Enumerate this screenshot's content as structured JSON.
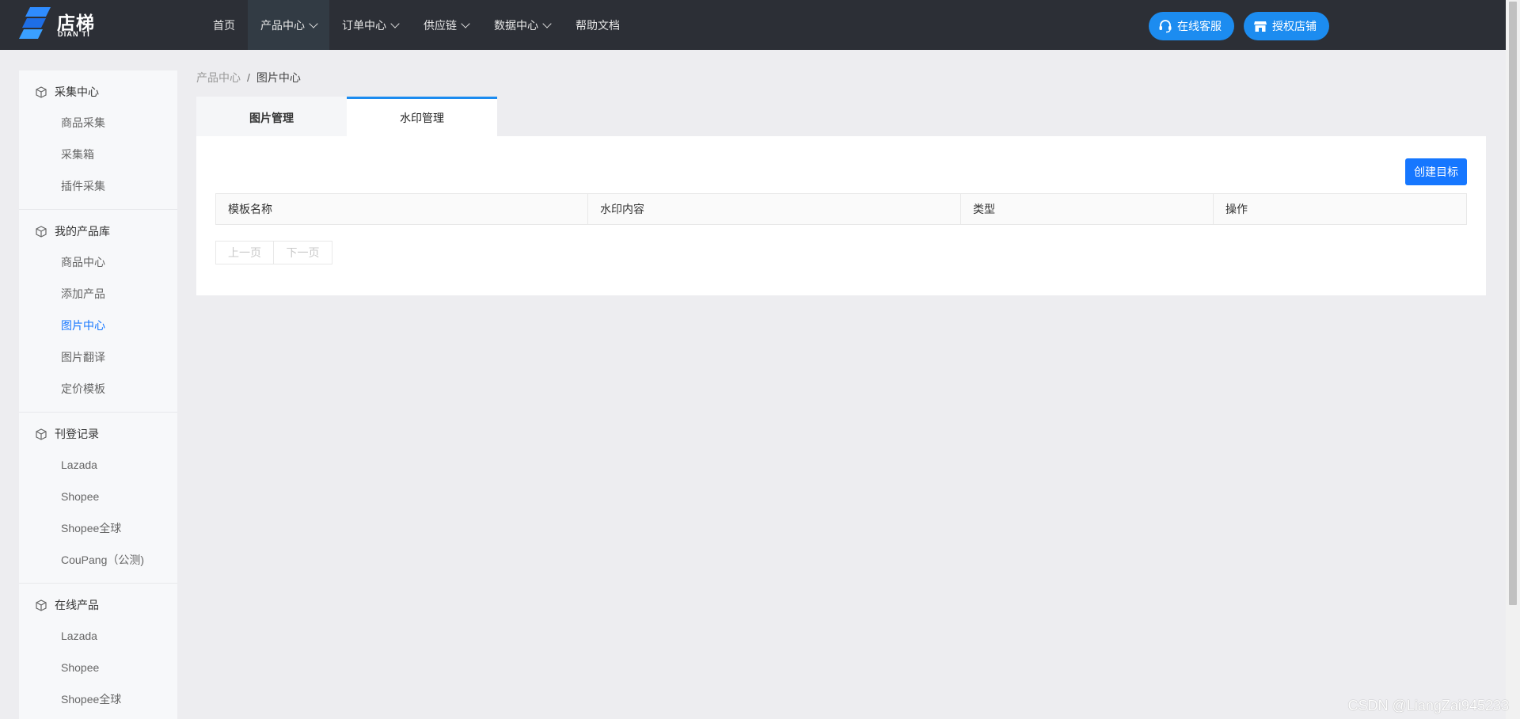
{
  "brand": {
    "name": "店梯",
    "sub": "DIAN TI"
  },
  "nav": [
    {
      "label": "首页",
      "dropdown": false,
      "active": false
    },
    {
      "label": "产品中心",
      "dropdown": true,
      "active": true
    },
    {
      "label": "订单中心",
      "dropdown": true,
      "active": false
    },
    {
      "label": "供应链",
      "dropdown": true,
      "active": false
    },
    {
      "label": "数据中心",
      "dropdown": true,
      "active": false
    },
    {
      "label": "帮助文档",
      "dropdown": false,
      "active": false
    }
  ],
  "header_buttons": {
    "service": "在线客服",
    "shop": "授权店铺"
  },
  "sidebar": [
    {
      "title": "采集中心",
      "items": [
        "商品采集",
        "采集箱",
        "插件采集"
      ]
    },
    {
      "title": "我的产品库",
      "items": [
        "商品中心",
        "添加产品",
        "图片中心",
        "图片翻译",
        "定价模板"
      ]
    },
    {
      "title": "刊登记录",
      "items": [
        "Lazada",
        "Shopee",
        "Shopee全球",
        "CouPang（公测)"
      ]
    },
    {
      "title": "在线产品",
      "items": [
        "Lazada",
        "Shopee",
        "Shopee全球"
      ]
    }
  ],
  "sidebar_active": "图片中心",
  "breadcrumb": {
    "parent": "产品中心",
    "separator": "/",
    "current": "图片中心"
  },
  "tabs": [
    {
      "label": "图片管理",
      "active": false
    },
    {
      "label": "水印管理",
      "active": true
    }
  ],
  "create_button": "创建目标",
  "table": {
    "columns": [
      "模板名称",
      "水印内容",
      "类型",
      "操作"
    ],
    "rows": []
  },
  "pager": {
    "prev": "上一页",
    "next": "下一页"
  },
  "watermark": "CSDN @LiangZai945233",
  "colors": {
    "header_bg": "#2c2f36",
    "accent": "#1677ff",
    "header_button": "#1c8cf0",
    "page_bg": "#ededf0"
  }
}
